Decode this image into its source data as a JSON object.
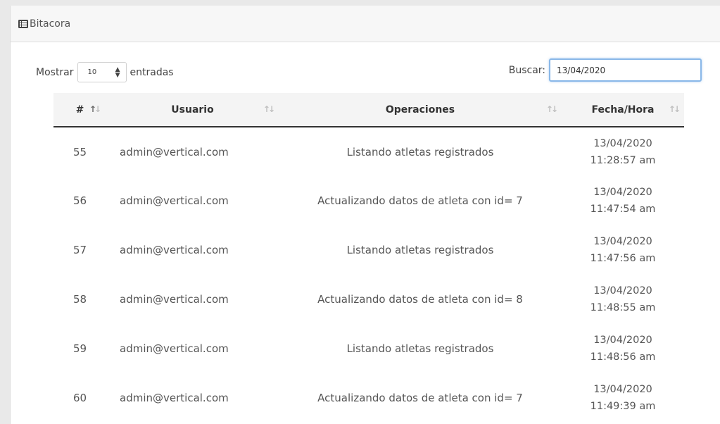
{
  "panel": {
    "title": "Bitacora",
    "icon": "list-table-icon"
  },
  "controls": {
    "show_label": "Mostrar",
    "length_value": "10",
    "entries_label": "entradas",
    "search_label": "Buscar:",
    "search_value": "13/04/2020"
  },
  "table": {
    "headers": [
      "#",
      "Usuario",
      "Operaciones",
      "Fecha/Hora"
    ],
    "rows": [
      {
        "id": "55",
        "user": "admin@vertical.com",
        "operation": "Listando atletas registrados",
        "date": "13/04/2020",
        "time": "11:28:57 am"
      },
      {
        "id": "56",
        "user": "admin@vertical.com",
        "operation": "Actualizando datos de atleta con id= 7",
        "date": "13/04/2020",
        "time": "11:47:54 am"
      },
      {
        "id": "57",
        "user": "admin@vertical.com",
        "operation": "Listando atletas registrados",
        "date": "13/04/2020",
        "time": "11:47:56 am"
      },
      {
        "id": "58",
        "user": "admin@vertical.com",
        "operation": "Actualizando datos de atleta con id= 8",
        "date": "13/04/2020",
        "time": "11:48:55 am"
      },
      {
        "id": "59",
        "user": "admin@vertical.com",
        "operation": "Listando atletas registrados",
        "date": "13/04/2020",
        "time": "11:48:56 am"
      },
      {
        "id": "60",
        "user": "admin@vertical.com",
        "operation": "Actualizando datos de atleta con id= 7",
        "date": "13/04/2020",
        "time": "11:49:39 am"
      }
    ]
  },
  "colors": {
    "header_bg": "#f7f7f7",
    "focus_border": "#8ab8e8",
    "table_header_bg": "#f4f4f4"
  }
}
